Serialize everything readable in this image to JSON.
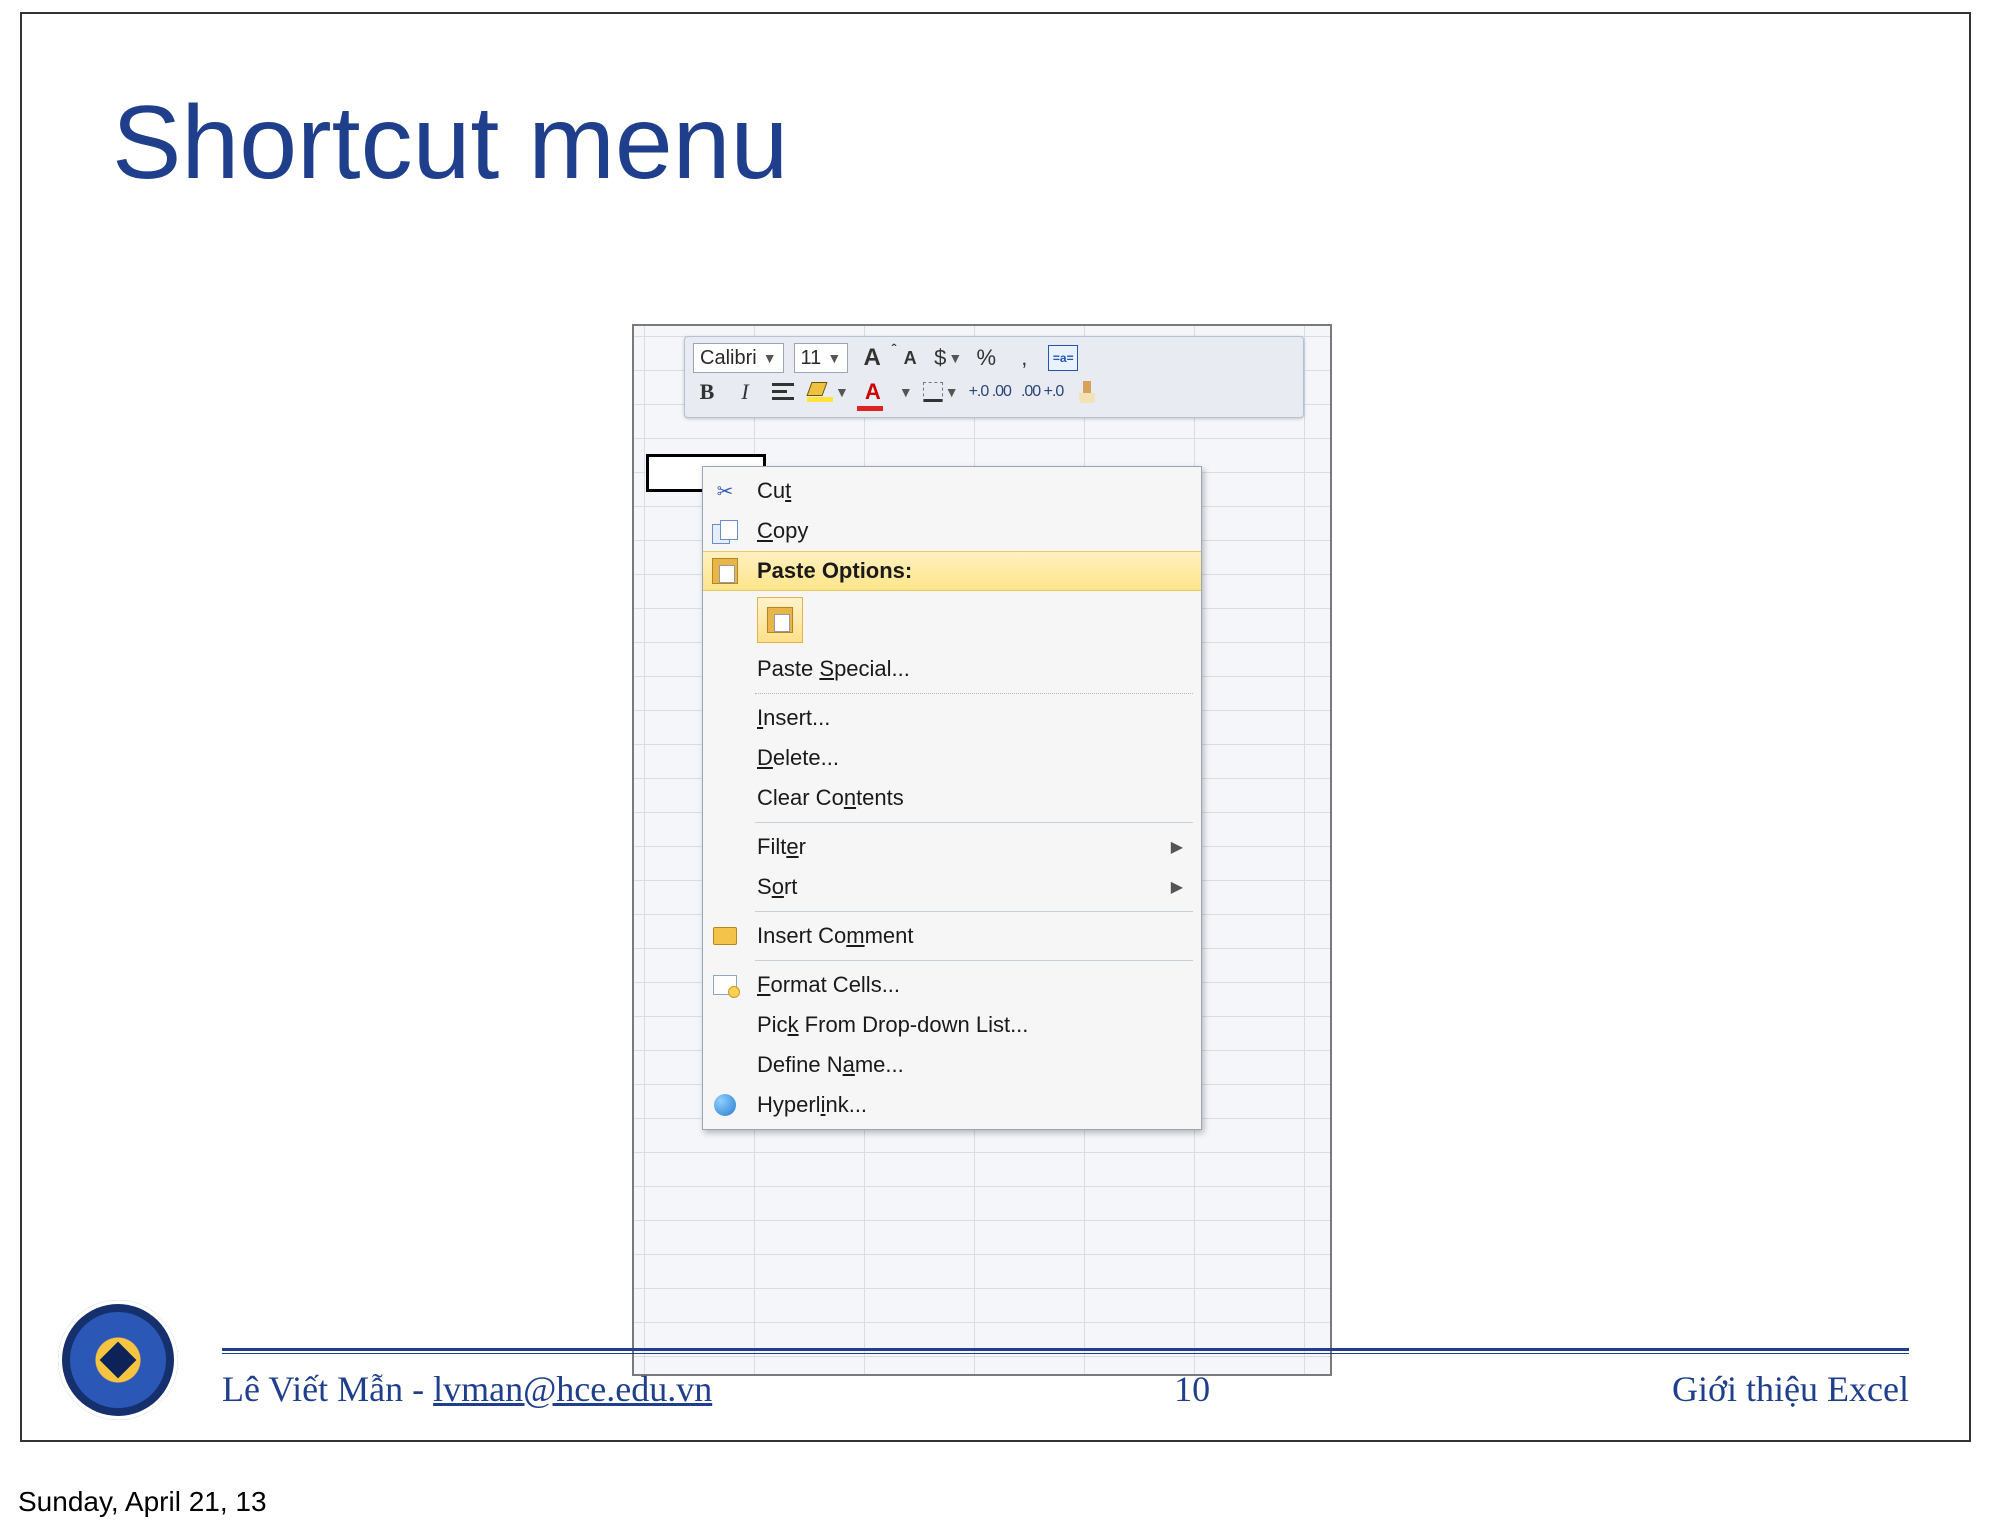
{
  "slide": {
    "title": "Shortcut menu",
    "page_number": "10",
    "footer_left_name": "Lê Viết Mẫn - ",
    "footer_left_mail": "lvman@hce.edu.vn",
    "footer_right": "Giới thiệu Excel"
  },
  "mini_toolbar": {
    "font_name": "Calibri",
    "font_size": "11",
    "currency": "$",
    "percent": "%",
    "comma": ",",
    "increase_decimal": "+.0 .00",
    "decrease_decimal": ".00 +.0",
    "bold": "B",
    "italic": "I",
    "font_color_letter": "A",
    "grow_font_letter": "A",
    "shrink_font_letter": "A",
    "abc_label": "=a="
  },
  "context_menu": {
    "cut": "Cut",
    "copy": "Copy",
    "paste_options": "Paste Options:",
    "paste_special": "Paste Special...",
    "insert": "Insert...",
    "delete": "Delete...",
    "clear_contents": "Clear Contents",
    "filter": "Filter",
    "sort": "Sort",
    "insert_comment": "Insert Comment",
    "format_cells": "Format Cells...",
    "pick_list": "Pick From Drop-down List...",
    "define_name": "Define Name...",
    "hyperlink": "Hyperlink..."
  },
  "timestamp": "Sunday, April 21, 13"
}
